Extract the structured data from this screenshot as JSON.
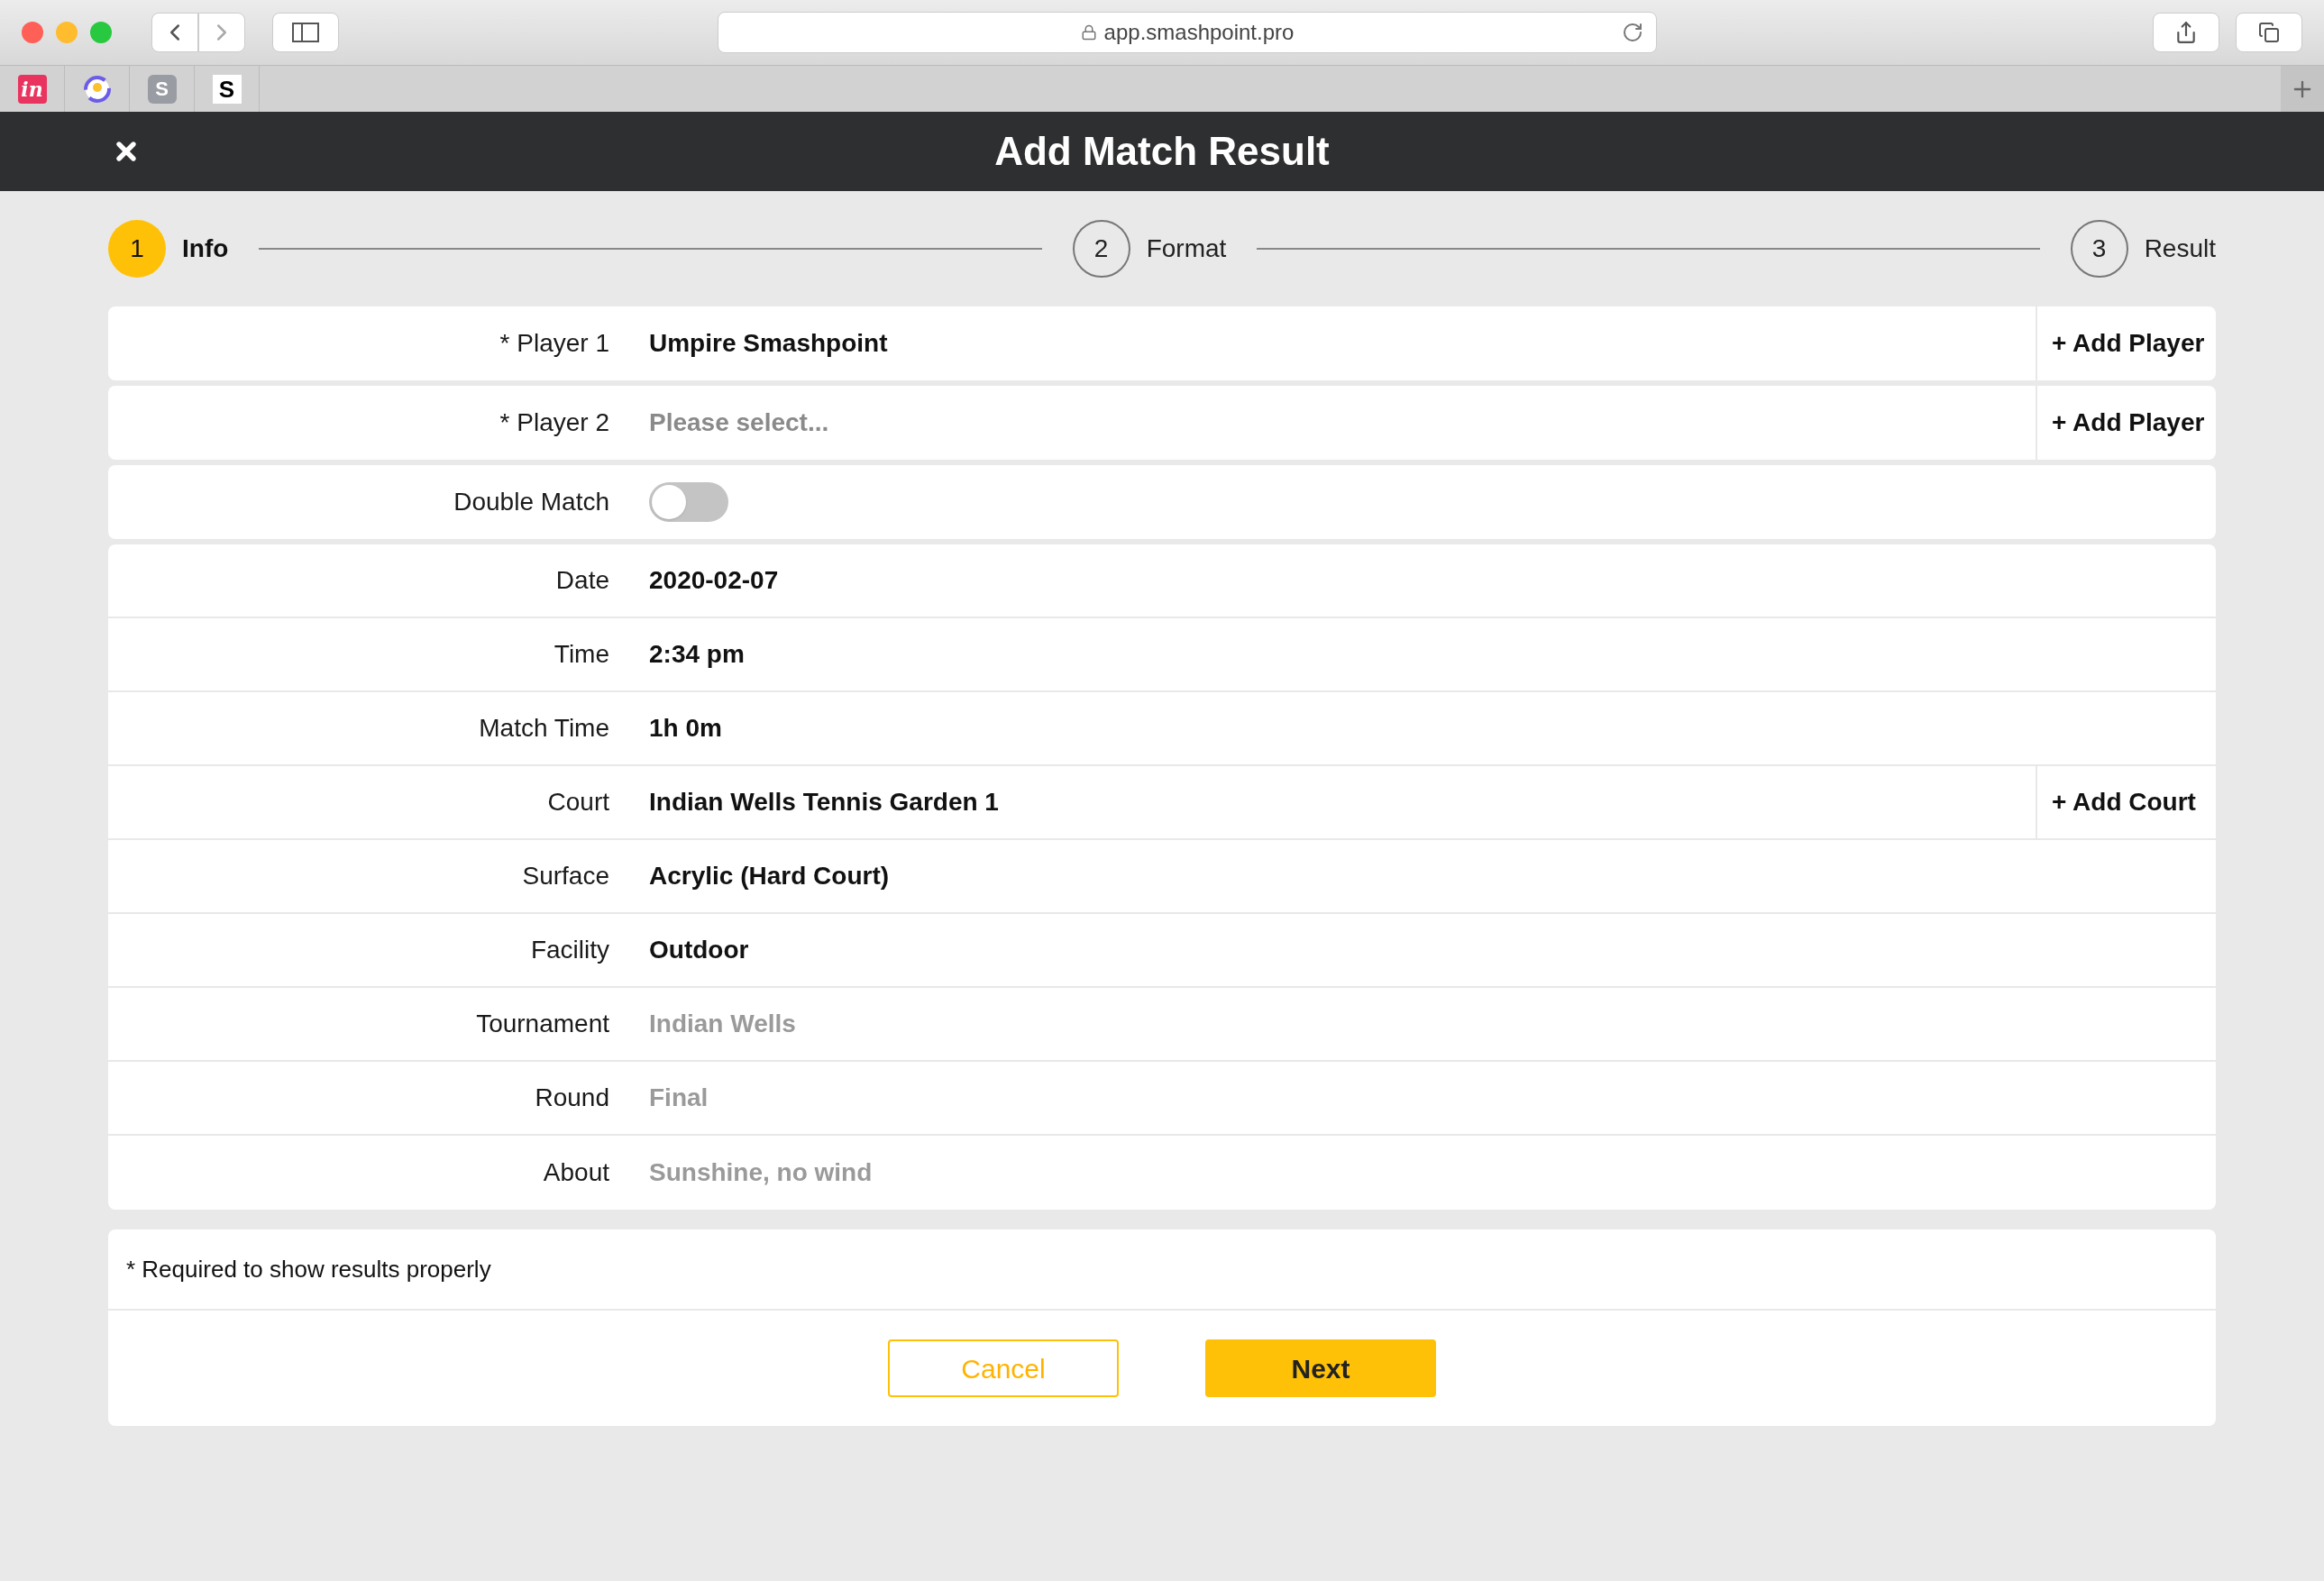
{
  "browser": {
    "url": "app.smashpoint.pro",
    "pinned_tabs": [
      {
        "kind": "invision",
        "text": "in"
      },
      {
        "kind": "ring"
      },
      {
        "kind": "badge",
        "text": "S"
      },
      {
        "kind": "mark",
        "text": "S"
      }
    ]
  },
  "header": {
    "title": "Add Match Result"
  },
  "steps": [
    {
      "number": "1",
      "label": "Info",
      "selected": true
    },
    {
      "number": "2",
      "label": "Format",
      "selected": false
    },
    {
      "number": "3",
      "label": "Result",
      "selected": false
    }
  ],
  "cards": [
    {
      "rows": [
        {
          "kind": "select",
          "label": "* Player 1",
          "value": "Umpire Smashpoint",
          "action": "+ Add Player"
        }
      ]
    },
    {
      "rows": [
        {
          "kind": "select",
          "label": "* Player 2",
          "placeholder": "Please select...",
          "action": "+ Add Player"
        }
      ]
    },
    {
      "rows": [
        {
          "kind": "toggle",
          "label": "Double Match",
          "on": false
        }
      ]
    },
    {
      "rows": [
        {
          "kind": "select",
          "label": "Date",
          "value": "2020-02-07"
        },
        {
          "kind": "select",
          "label": "Time",
          "value": "2:34 pm"
        },
        {
          "kind": "select",
          "label": "Match Time",
          "value": "1h 0m"
        },
        {
          "kind": "select",
          "label": "Court",
          "value": "Indian Wells Tennis Garden 1",
          "action": "+ Add Court"
        },
        {
          "kind": "select",
          "label": "Surface",
          "value": "Acrylic (Hard Court)"
        },
        {
          "kind": "select",
          "label": "Facility",
          "value": "Outdoor"
        },
        {
          "kind": "input",
          "label": "Tournament",
          "placeholder": "Indian Wells"
        },
        {
          "kind": "input",
          "label": "Round",
          "placeholder": "Final"
        },
        {
          "kind": "input",
          "label": "About",
          "placeholder": "Sunshine, no wind"
        }
      ]
    }
  ],
  "note": "* Required to show results properly",
  "buttons": [
    {
      "kind": "secondary",
      "label": "Cancel"
    },
    {
      "kind": "primary",
      "label": "Next"
    }
  ]
}
